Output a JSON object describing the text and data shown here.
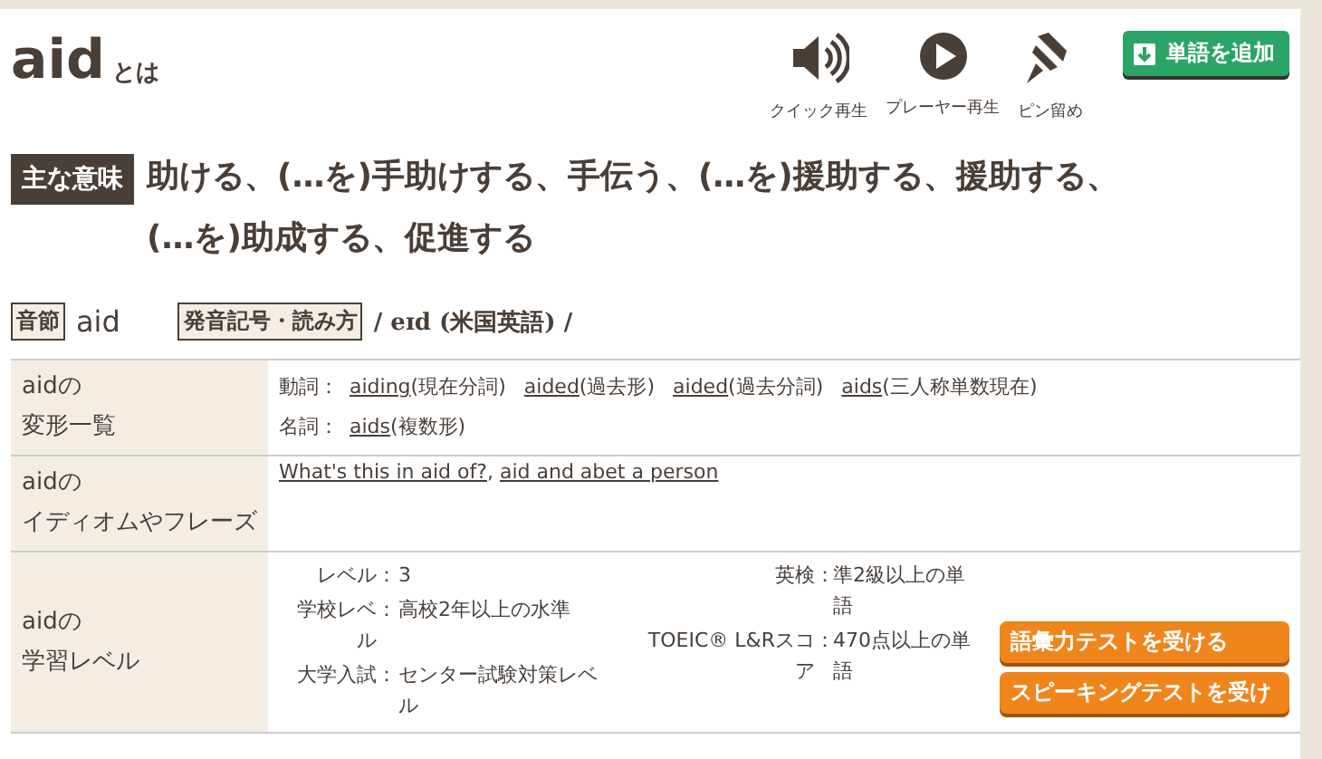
{
  "header": {
    "word": "aid",
    "suffix": "とは",
    "actions": [
      {
        "kind": "speaker",
        "label": "クイック再生"
      },
      {
        "kind": "play",
        "label": "プレーヤー再生"
      },
      {
        "kind": "pin",
        "label": "ピン留め"
      }
    ],
    "add_button": "単語を追加"
  },
  "meaning": {
    "badge": "主な意味",
    "text": "助ける、(…を)手助けする、手伝う、(…を)援助する、援助する、(…を)助成する、促進する"
  },
  "pronunciation": {
    "syllable_label": "音節",
    "syllable": "aid",
    "ipa_label": "発音記号・読み方",
    "ipa": "/ eɪd (米国英語) /"
  },
  "rows": [
    {
      "kind": "forms",
      "heading": [
        "aidの",
        "変形一覧"
      ],
      "lines": [
        {
          "pos": "動詞：",
          "items": [
            {
              "word": "aiding",
              "note": "(現在分詞)"
            },
            {
              "word": "aided",
              "note": "(過去形)"
            },
            {
              "word": "aided",
              "note": "(過去分詞)"
            },
            {
              "word": "aids",
              "note": "(三人称単数現在)"
            }
          ]
        },
        {
          "pos": "名詞：",
          "items": [
            {
              "word": "aids",
              "note": "(複数形)"
            }
          ]
        }
      ]
    },
    {
      "kind": "idioms",
      "heading": [
        "aidの",
        "イディオムやフレーズ"
      ],
      "separator": ", ",
      "links": [
        "What's this in aid of?",
        "aid and abet a person"
      ]
    },
    {
      "kind": "level",
      "heading": [
        "aidの",
        "学習レベル"
      ],
      "separator": "：",
      "left": [
        {
          "label": "レベル",
          "value": "3"
        },
        {
          "label": "学校レベル",
          "value": "高校2年以上の水準"
        },
        {
          "label": "大学入試",
          "value": "センター試験対策レベル"
        }
      ],
      "right": [
        {
          "label": "英検",
          "value": "準2級以上の単語"
        },
        {
          "label": "TOEIC® L&Rスコア",
          "value": "470点以上の単語"
        }
      ],
      "buttons": [
        "語彙力テストを受ける",
        "スピーキングテストを受け"
      ]
    }
  ]
}
